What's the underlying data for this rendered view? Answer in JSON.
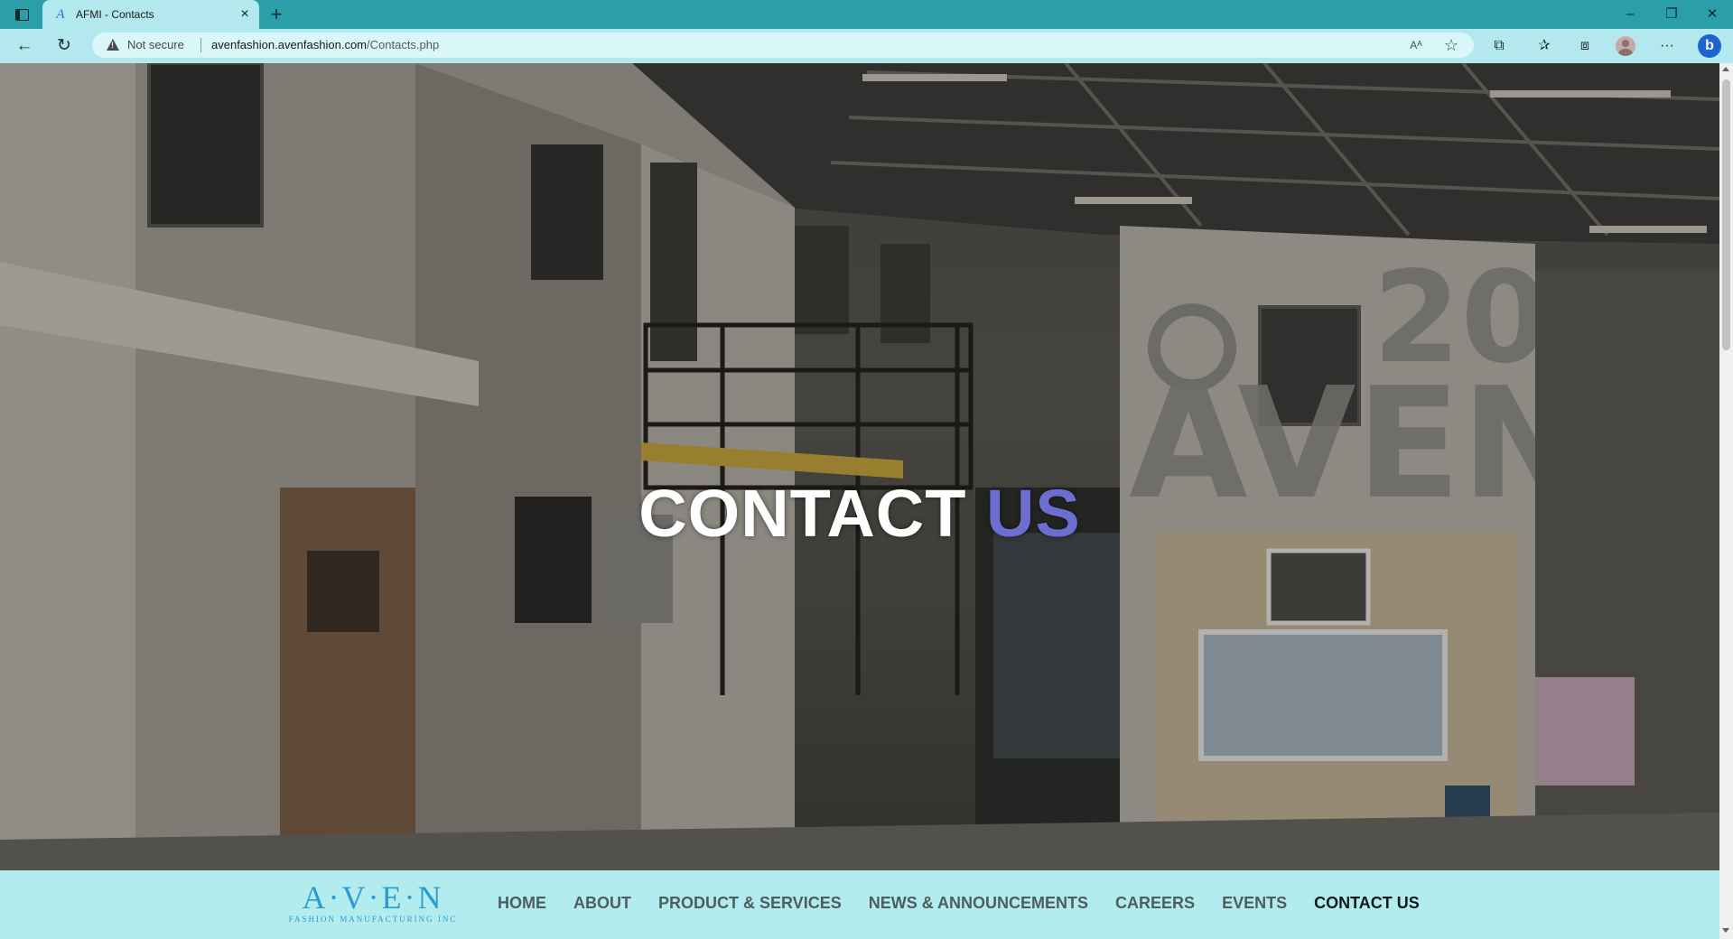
{
  "browser": {
    "tab": {
      "title": "AFMI - Contacts",
      "close": "×",
      "favicon": "A"
    },
    "new_tab": "+",
    "window": {
      "minimize": "–",
      "restore": "❐",
      "close": "✕"
    },
    "nav": {
      "back": "←",
      "reload": "↻"
    },
    "address": {
      "security_label": "Not secure",
      "url_host": "avenfashion.avenfashion.com",
      "url_path": "/Contacts.php"
    },
    "icons": {
      "read_aloud": "Aᴬ",
      "favorite": "☆",
      "extensions": "⧉",
      "favorites_bar": "✰",
      "collections": "⧈",
      "more": "···",
      "bing": "b"
    }
  },
  "hero": {
    "title_main": "CONTACT",
    "title_accent": "US",
    "accent_color": "#6c6fd0"
  },
  "navbar": {
    "logo": {
      "main": "A·V·E·N",
      "sub": "FASHION MANUFACTURING INC"
    },
    "items": [
      {
        "label": "HOME",
        "active": false
      },
      {
        "label": "ABOUT",
        "active": false
      },
      {
        "label": "PRODUCT & SERVICES",
        "active": false
      },
      {
        "label": "NEWS & ANNOUNCEMENTS",
        "active": false
      },
      {
        "label": "CAREERS",
        "active": false
      },
      {
        "label": "EVENTS",
        "active": false
      },
      {
        "label": "CONTACT US",
        "active": true
      }
    ]
  }
}
